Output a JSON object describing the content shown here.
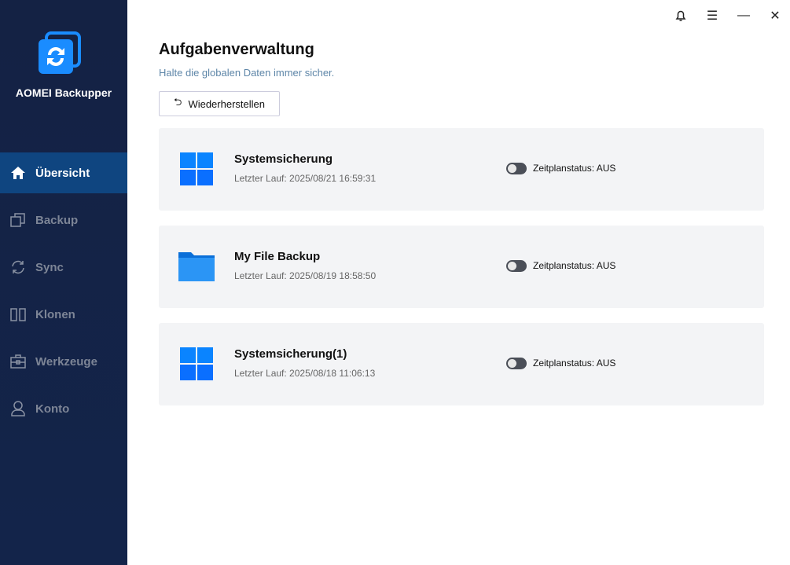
{
  "app": {
    "name": "AOMEI Backupper"
  },
  "nav": [
    {
      "label": "Übersicht"
    },
    {
      "label": "Backup"
    },
    {
      "label": "Sync"
    },
    {
      "label": "Klonen"
    },
    {
      "label": "Werkzeuge"
    },
    {
      "label": "Konto"
    }
  ],
  "page": {
    "title": "Aufgabenverwaltung",
    "subtitle": "Halte die globalen Daten immer sicher.",
    "restore_label": "Wiederherstellen"
  },
  "tasks": [
    {
      "name": "Systemsicherung",
      "last_run": "Letzter Lauf: 2025/08/21 16:59:31",
      "schedule": "Zeitplanstatus: AUS",
      "icon": "windows-icon"
    },
    {
      "name": "My File Backup",
      "last_run": "Letzter Lauf: 2025/08/19 18:58:50",
      "schedule": "Zeitplanstatus: AUS",
      "icon": "folder-icon"
    },
    {
      "name": "Systemsicherung(1)",
      "last_run": "Letzter Lauf: 2025/08/18 11:06:13",
      "schedule": "Zeitplanstatus: AUS",
      "icon": "windows-icon"
    }
  ]
}
